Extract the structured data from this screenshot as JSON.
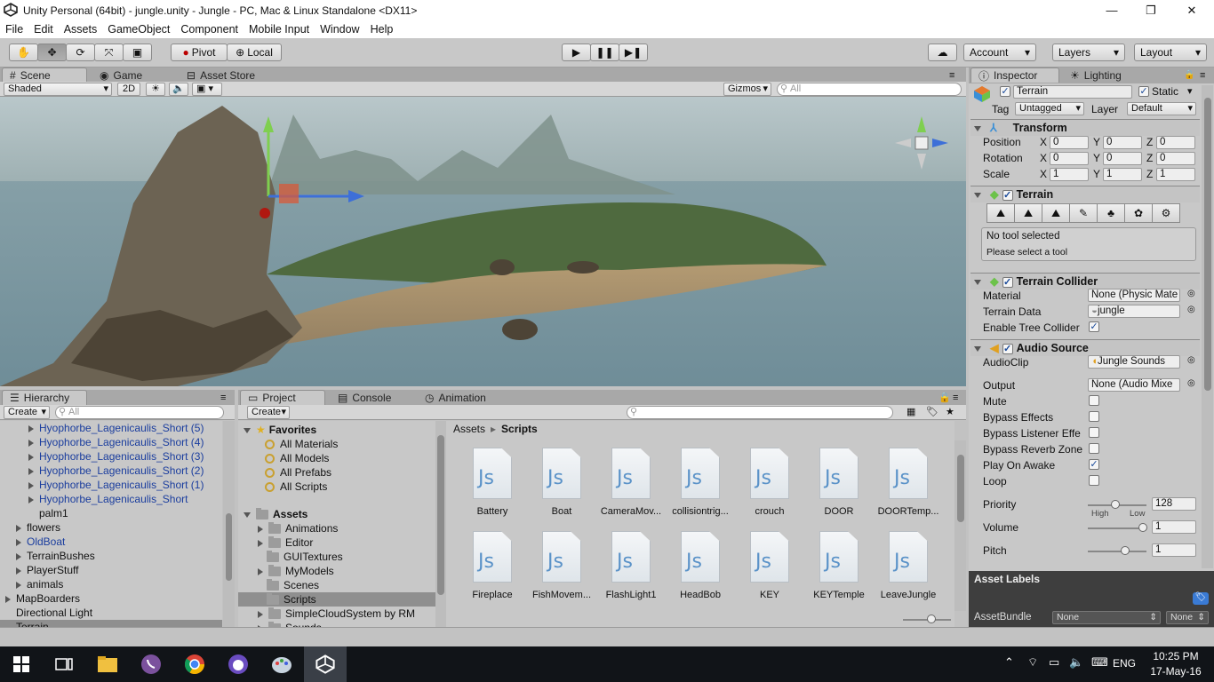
{
  "window": {
    "title": "Unity Personal (64bit) - jungle.unity - Jungle - PC, Mac & Linux Standalone <DX11>",
    "minimize": "—",
    "maximize": "❐",
    "close": "✕"
  },
  "menu": [
    "File",
    "Edit",
    "Assets",
    "GameObject",
    "Component",
    "Mobile Input",
    "Window",
    "Help"
  ],
  "toolbar": {
    "pivot": "Pivot",
    "local": "Local",
    "account": "Account",
    "layers": "Layers",
    "layout": "Layout"
  },
  "scene_panel": {
    "tabs": [
      "Scene",
      "Game",
      "Asset Store"
    ],
    "shading": "Shaded",
    "mode_2d": "2D",
    "gizmos": "Gizmos",
    "search_placeholder": "All"
  },
  "hierarchy": {
    "tab": "Hierarchy",
    "create": "Create",
    "search_placeholder": "All",
    "items": [
      {
        "label": "Hyophorbe_Lagenicaulis_Short (5)",
        "prefab": true,
        "indent": 1,
        "arrow": true
      },
      {
        "label": "Hyophorbe_Lagenicaulis_Short (4)",
        "prefab": true,
        "indent": 1,
        "arrow": true
      },
      {
        "label": "Hyophorbe_Lagenicaulis_Short (3)",
        "prefab": true,
        "indent": 1,
        "arrow": true
      },
      {
        "label": "Hyophorbe_Lagenicaulis_Short (2)",
        "prefab": true,
        "indent": 1,
        "arrow": true
      },
      {
        "label": "Hyophorbe_Lagenicaulis_Short (1)",
        "prefab": true,
        "indent": 1,
        "arrow": true
      },
      {
        "label": "Hyophorbe_Lagenicaulis_Short",
        "prefab": true,
        "indent": 1,
        "arrow": true
      },
      {
        "label": "palm1",
        "prefab": false,
        "indent": 1,
        "arrow": false
      },
      {
        "label": "flowers",
        "prefab": false,
        "indent": 0.5,
        "arrow": true
      },
      {
        "label": "OldBoat",
        "prefab": true,
        "indent": 0.5,
        "arrow": true
      },
      {
        "label": "TerrainBushes",
        "prefab": false,
        "indent": 0.5,
        "arrow": true
      },
      {
        "label": "PlayerStuff",
        "prefab": false,
        "indent": 0.5,
        "arrow": true
      },
      {
        "label": "animals",
        "prefab": false,
        "indent": 0.5,
        "arrow": true
      },
      {
        "label": "MapBoarders",
        "prefab": false,
        "indent": 0,
        "arrow": true
      },
      {
        "label": "Directional Light",
        "prefab": false,
        "indent": 0,
        "arrow": false
      },
      {
        "label": "Terrain",
        "prefab": false,
        "indent": 0,
        "arrow": false,
        "selected": true
      }
    ]
  },
  "project": {
    "tabs": [
      "Project",
      "Console",
      "Animation"
    ],
    "create": "Create",
    "favorites_label": "Favorites",
    "favorites": [
      "All Materials",
      "All Models",
      "All Prefabs",
      "All Scripts"
    ],
    "assets_label": "Assets",
    "folders": [
      {
        "label": "Animations",
        "arrow": true
      },
      {
        "label": "Editor",
        "arrow": true
      },
      {
        "label": "GUITextures",
        "arrow": false
      },
      {
        "label": "MyModels",
        "arrow": true
      },
      {
        "label": "Scenes",
        "arrow": false
      },
      {
        "label": "Scripts",
        "arrow": false,
        "selected": true
      },
      {
        "label": "SimpleCloudSystem by RM",
        "arrow": true
      },
      {
        "label": "Sounds",
        "arrow": true
      }
    ],
    "breadcrumb": [
      "Assets",
      "Scripts"
    ],
    "files": [
      "Battery",
      "Boat",
      "CameraMov...",
      "collisiontrig...",
      "crouch",
      "DOOR",
      "DOORTemp...",
      "Fireplace",
      "FishMovem...",
      "FlashLight1",
      "HeadBob",
      "KEY",
      "KEYTemple",
      "LeaveJungle"
    ],
    "file_icon": "Js"
  },
  "inspector": {
    "tabs": [
      "Inspector",
      "Lighting"
    ],
    "object_name": "Terrain",
    "static_label": "Static",
    "tag_label": "Tag",
    "tag_value": "Untagged",
    "layer_label": "Layer",
    "layer_value": "Default",
    "transform": {
      "title": "Transform",
      "rows": [
        {
          "label": "Position",
          "x": "0",
          "y": "0",
          "z": "0"
        },
        {
          "label": "Rotation",
          "x": "0",
          "y": "0",
          "z": "0"
        },
        {
          "label": "Scale",
          "x": "1",
          "y": "1",
          "z": "1"
        }
      ],
      "axis": [
        "X",
        "Y",
        "Z"
      ]
    },
    "terrain": {
      "title": "Terrain",
      "msg1": "No tool selected",
      "msg2": "Please select a tool"
    },
    "terrain_collider": {
      "title": "Terrain Collider",
      "material_label": "Material",
      "material_value": "None (Physic Mate",
      "data_label": "Terrain Data",
      "data_value": "jungle",
      "tree_label": "Enable Tree Collider"
    },
    "audio": {
      "title": "Audio Source",
      "clip_label": "AudioClip",
      "clip_value": "Jungle Sounds",
      "output_label": "Output",
      "output_value": "None (Audio Mixe",
      "mute": "Mute",
      "bypass_effects": "Bypass Effects",
      "bypass_listener": "Bypass Listener Effe",
      "bypass_reverb": "Bypass Reverb Zone",
      "play_on_awake": "Play On Awake",
      "loop": "Loop",
      "priority_label": "Priority",
      "priority_value": "128",
      "high": "High",
      "low": "Low",
      "volume_label": "Volume",
      "volume_value": "1",
      "pitch_label": "Pitch",
      "pitch_value": "1",
      "priority_fraction": 0.5,
      "volume_fraction": 1.0,
      "pitch_fraction": 0.67
    },
    "asset_labels": "Asset Labels",
    "assetbundle_label": "AssetBundle",
    "assetbundle_value": "None",
    "assetbundle_variant": "None"
  },
  "taskbar": {
    "time": "10:25 PM",
    "date": "17-May-16",
    "lang": "ENG"
  }
}
